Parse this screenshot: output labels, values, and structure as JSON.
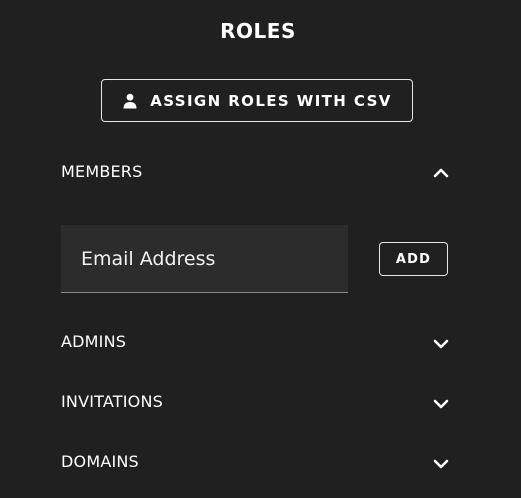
{
  "header": {
    "title": "ROLES"
  },
  "csv_button": {
    "label": "ASSIGN ROLES WITH CSV",
    "icon": "person-icon"
  },
  "sections": {
    "members": {
      "label": "MEMBERS",
      "expanded": true
    },
    "admins": {
      "label": "ADMINS",
      "expanded": false
    },
    "invitations": {
      "label": "INVITATIONS",
      "expanded": false
    },
    "domains": {
      "label": "DOMAINS",
      "expanded": false
    }
  },
  "members_form": {
    "email_placeholder": "Email Address",
    "email_value": "",
    "add_label": "ADD"
  },
  "colors": {
    "background": "#202020",
    "input_background": "#2c2c2c",
    "foreground": "#ffffff"
  }
}
